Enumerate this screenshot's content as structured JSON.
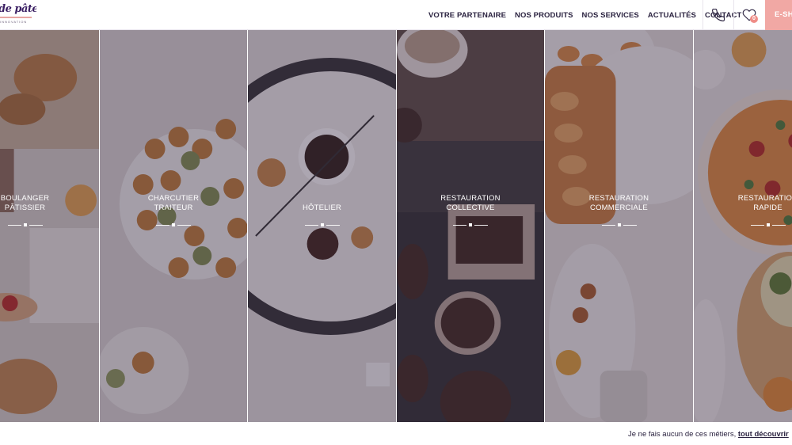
{
  "header": {
    "logo_text": "de pâtes",
    "logo_tagline": "INNOVATION",
    "nav": [
      "VOTRE PARTENAIRE",
      "NOS PRODUITS",
      "NOS SERVICES",
      "ACTUALITÉS",
      "CONTACT"
    ],
    "favorites_count": "0",
    "eshop_label": "E-SHOP",
    "icons": {
      "phone": "phone-icon",
      "favorites": "heart-icon"
    }
  },
  "panels": [
    {
      "lines": [
        "BOULANGER",
        "PÂTISSIER"
      ]
    },
    {
      "lines": [
        "CHARCUTIER",
        "TRAITEUR"
      ]
    },
    {
      "lines": [
        "HÔTELIER"
      ]
    },
    {
      "lines": [
        "RESTAURATION",
        "COLLECTIVE"
      ]
    },
    {
      "lines": [
        "RESTAURATION",
        "COMMERCIALE"
      ]
    },
    {
      "lines": [
        "RESTAURATION",
        "RAPIDE"
      ]
    }
  ],
  "footer": {
    "text": "Je ne fais aucun de ces métiers,",
    "link": "tout découvrir"
  },
  "colors": {
    "brand": "#3a1f63",
    "accent": "#f1a8a4",
    "overlay": "#3a2c46"
  }
}
